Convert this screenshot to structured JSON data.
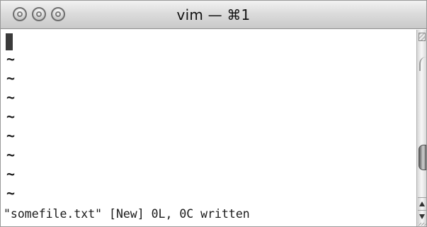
{
  "window": {
    "title": "vim — ⌘1"
  },
  "editor": {
    "empty_line_marker": "~",
    "empty_lines": [
      "~",
      "~",
      "~",
      "~",
      "~",
      "~",
      "~",
      "~"
    ],
    "status_message": "\"somefile.txt\" [New] 0L, 0C written"
  },
  "icons": {
    "close": "close-icon",
    "minimize": "minimize-icon",
    "zoom": "zoom-icon",
    "scroll_up": "chevron-up-icon",
    "scroll_down": "chevron-down-icon"
  },
  "colors": {
    "text": "#1a1a1a",
    "cursor": "#3a3a3a",
    "background": "#ffffff"
  }
}
